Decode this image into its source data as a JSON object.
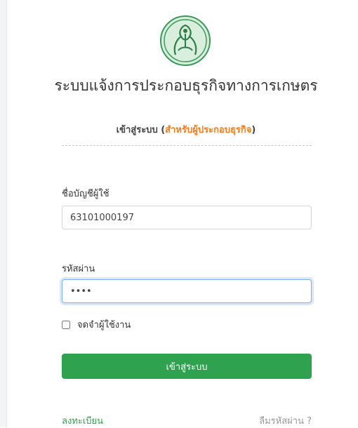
{
  "logo": {
    "icon": "agriculture-ministry-emblem",
    "colors": {
      "ring": "#3a9a5a",
      "fill": "#d9efdd"
    }
  },
  "header": {
    "title": "ระบบแจ้งการประกอบธุรกิจทางการเกษตร",
    "subtitle_prefix": "เข้าสู่ระบบ (",
    "subtitle_accent": "สำหรับผู้ประกอบธุรกิจ",
    "subtitle_suffix": ")",
    "accent_color": "#f57c1f"
  },
  "form": {
    "username_label": "ชื่อบัญชีผู้ใช้",
    "username_value": "63101000197",
    "password_label": "รหัสผ่าน",
    "password_value": "1234",
    "remember_label": "จดจำผู้ใช้งาน",
    "remember_checked": false,
    "login_label": "เข้าสู่ระบบ",
    "button_color": "#2ea24f"
  },
  "footer": {
    "register_label": "ลงทะเบียน",
    "forgot_label": "ลืมรหัสผ่าน ?"
  }
}
